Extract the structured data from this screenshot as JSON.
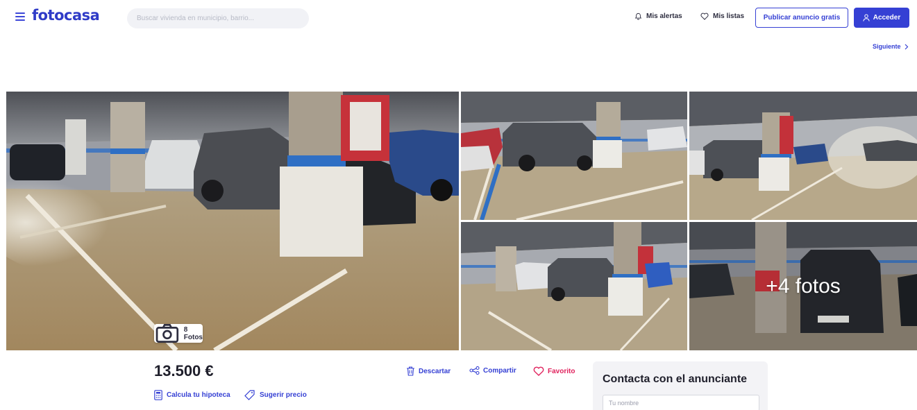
{
  "header": {
    "logo": "fotocasa",
    "search_placeholder": "Buscar vivienda en municipio, barrio...",
    "alerts_label": "Mis alertas",
    "lists_label": "Mis listas",
    "publish_label": "Publicar anuncio gratis",
    "login_label": "Acceder",
    "next_label": "Siguiente"
  },
  "gallery": {
    "photos_badge": "8 Fotos",
    "more_photos": "+4 fotos"
  },
  "listing": {
    "price": "13.500 €",
    "mortgage_label": "Calcula tu hipoteca",
    "suggest_price_label": "Sugerir precio",
    "discard_label": "Descartar",
    "share_label": "Compartir",
    "favorite_label": "Favorito"
  },
  "contact": {
    "title": "Contacta con el anunciante",
    "name_placeholder": "Tu nombre"
  },
  "colors": {
    "brand_blue": "#3540d4",
    "favorite_pink": "#e0225d",
    "parking_blue_stripe": "#2f6fc4"
  }
}
